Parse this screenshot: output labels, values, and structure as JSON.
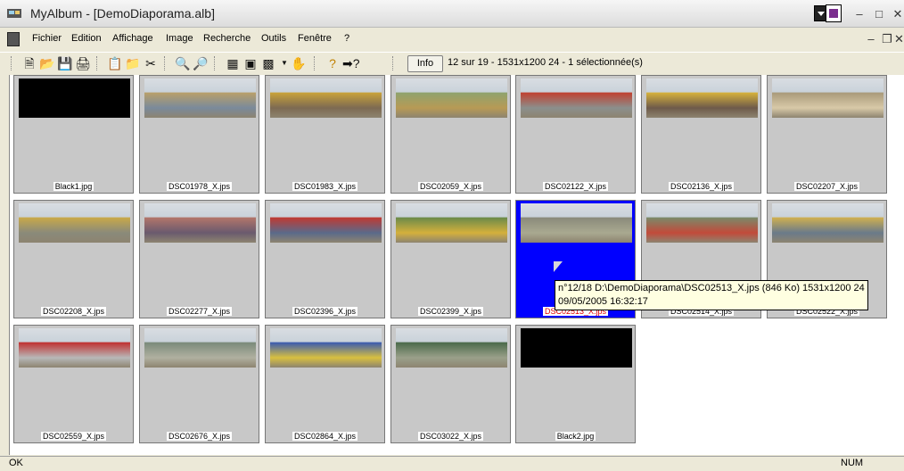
{
  "window": {
    "title": "MyAlbum - [DemoDiaporama.alb]"
  },
  "menu": [
    "Fichier",
    "Edition",
    "Affichage",
    "Image",
    "Recherche",
    "Outils",
    "Fenêtre",
    "?"
  ],
  "toolbar": {
    "info_label": "Info",
    "status_text": "12 sur 19 - 1531x1200 24 - 1 sélectionnée(s)",
    "icons": [
      "new-icon",
      "open-icon",
      "save-icon",
      "print-icon",
      "paste-icon",
      "open-folder-icon",
      "cut-icon",
      "binoculars-icon",
      "find-replace-icon",
      "palette-icon",
      "zoom-icon",
      "slideshow-icon",
      "hand-icon",
      "help-icon",
      "context-help-icon"
    ]
  },
  "thumbnails": [
    {
      "name": "Black1.jpg",
      "black": true
    },
    {
      "name": "DSC01978_X.jps",
      "colors": [
        "#b9a06a",
        "#7a8a9b"
      ]
    },
    {
      "name": "DSC01983_X.jps",
      "colors": [
        "#c9a23a",
        "#7d6a52"
      ]
    },
    {
      "name": "DSC02059_X.jps",
      "colors": [
        "#8fa36e",
        "#b79a55"
      ]
    },
    {
      "name": "DSC02122_X.jps",
      "colors": [
        "#c04030",
        "#8b8f8c"
      ]
    },
    {
      "name": "DSC02136_X.jps",
      "colors": [
        "#d6b23c",
        "#6e5a4a"
      ]
    },
    {
      "name": "DSC02207_X.jps",
      "colors": [
        "#a99a7a",
        "#d8c9a8"
      ]
    },
    {
      "name": "DSC02208_X.jps",
      "colors": [
        "#c9a949",
        "#8a8a7a"
      ]
    },
    {
      "name": "DSC02277_X.jps",
      "colors": [
        "#b3766a",
        "#6a5a6e"
      ]
    },
    {
      "name": "DSC02396_X.jps",
      "colors": [
        "#c03a32",
        "#5a6a8a"
      ]
    },
    {
      "name": "DSC02399_X.jps",
      "colors": [
        "#6a8a4a",
        "#d4b03c"
      ]
    },
    {
      "name": "DSC02513_X.jps",
      "colors": [
        "#8a8a7a",
        "#a9a990"
      ],
      "selected": true
    },
    {
      "name": "DSC02514_X.jps",
      "colors": [
        "#7a8a6a",
        "#c24a3a"
      ]
    },
    {
      "name": "DSC02522_X.jps",
      "colors": [
        "#d0b050",
        "#6a7a8a"
      ]
    },
    {
      "name": "DSC02559_X.jps",
      "colors": [
        "#c03030",
        "#b8b8b8"
      ]
    },
    {
      "name": "DSC02676_X.jps",
      "colors": [
        "#7a8a7a",
        "#b0b0a0"
      ]
    },
    {
      "name": "DSC02864_X.jps",
      "colors": [
        "#3a5ab0",
        "#d8c040"
      ]
    },
    {
      "name": "DSC03022_X.jps",
      "colors": [
        "#4a6a4a",
        "#9aa08a"
      ]
    },
    {
      "name": "Black2.jpg",
      "black": true
    }
  ],
  "tooltip": {
    "line1": "n°12/18   D:\\DemoDiaporama\\DSC02513_X.jps  (846 Ko)  1531x1200 24",
    "line2": "09/05/2005 16:32:17"
  },
  "statusbar": {
    "left": "OK",
    "right": "NUM"
  },
  "colors": {
    "selection": "#0000ff",
    "tooltip_bg": "#ffffe1",
    "thumb_bg": "#c8c8c8"
  }
}
